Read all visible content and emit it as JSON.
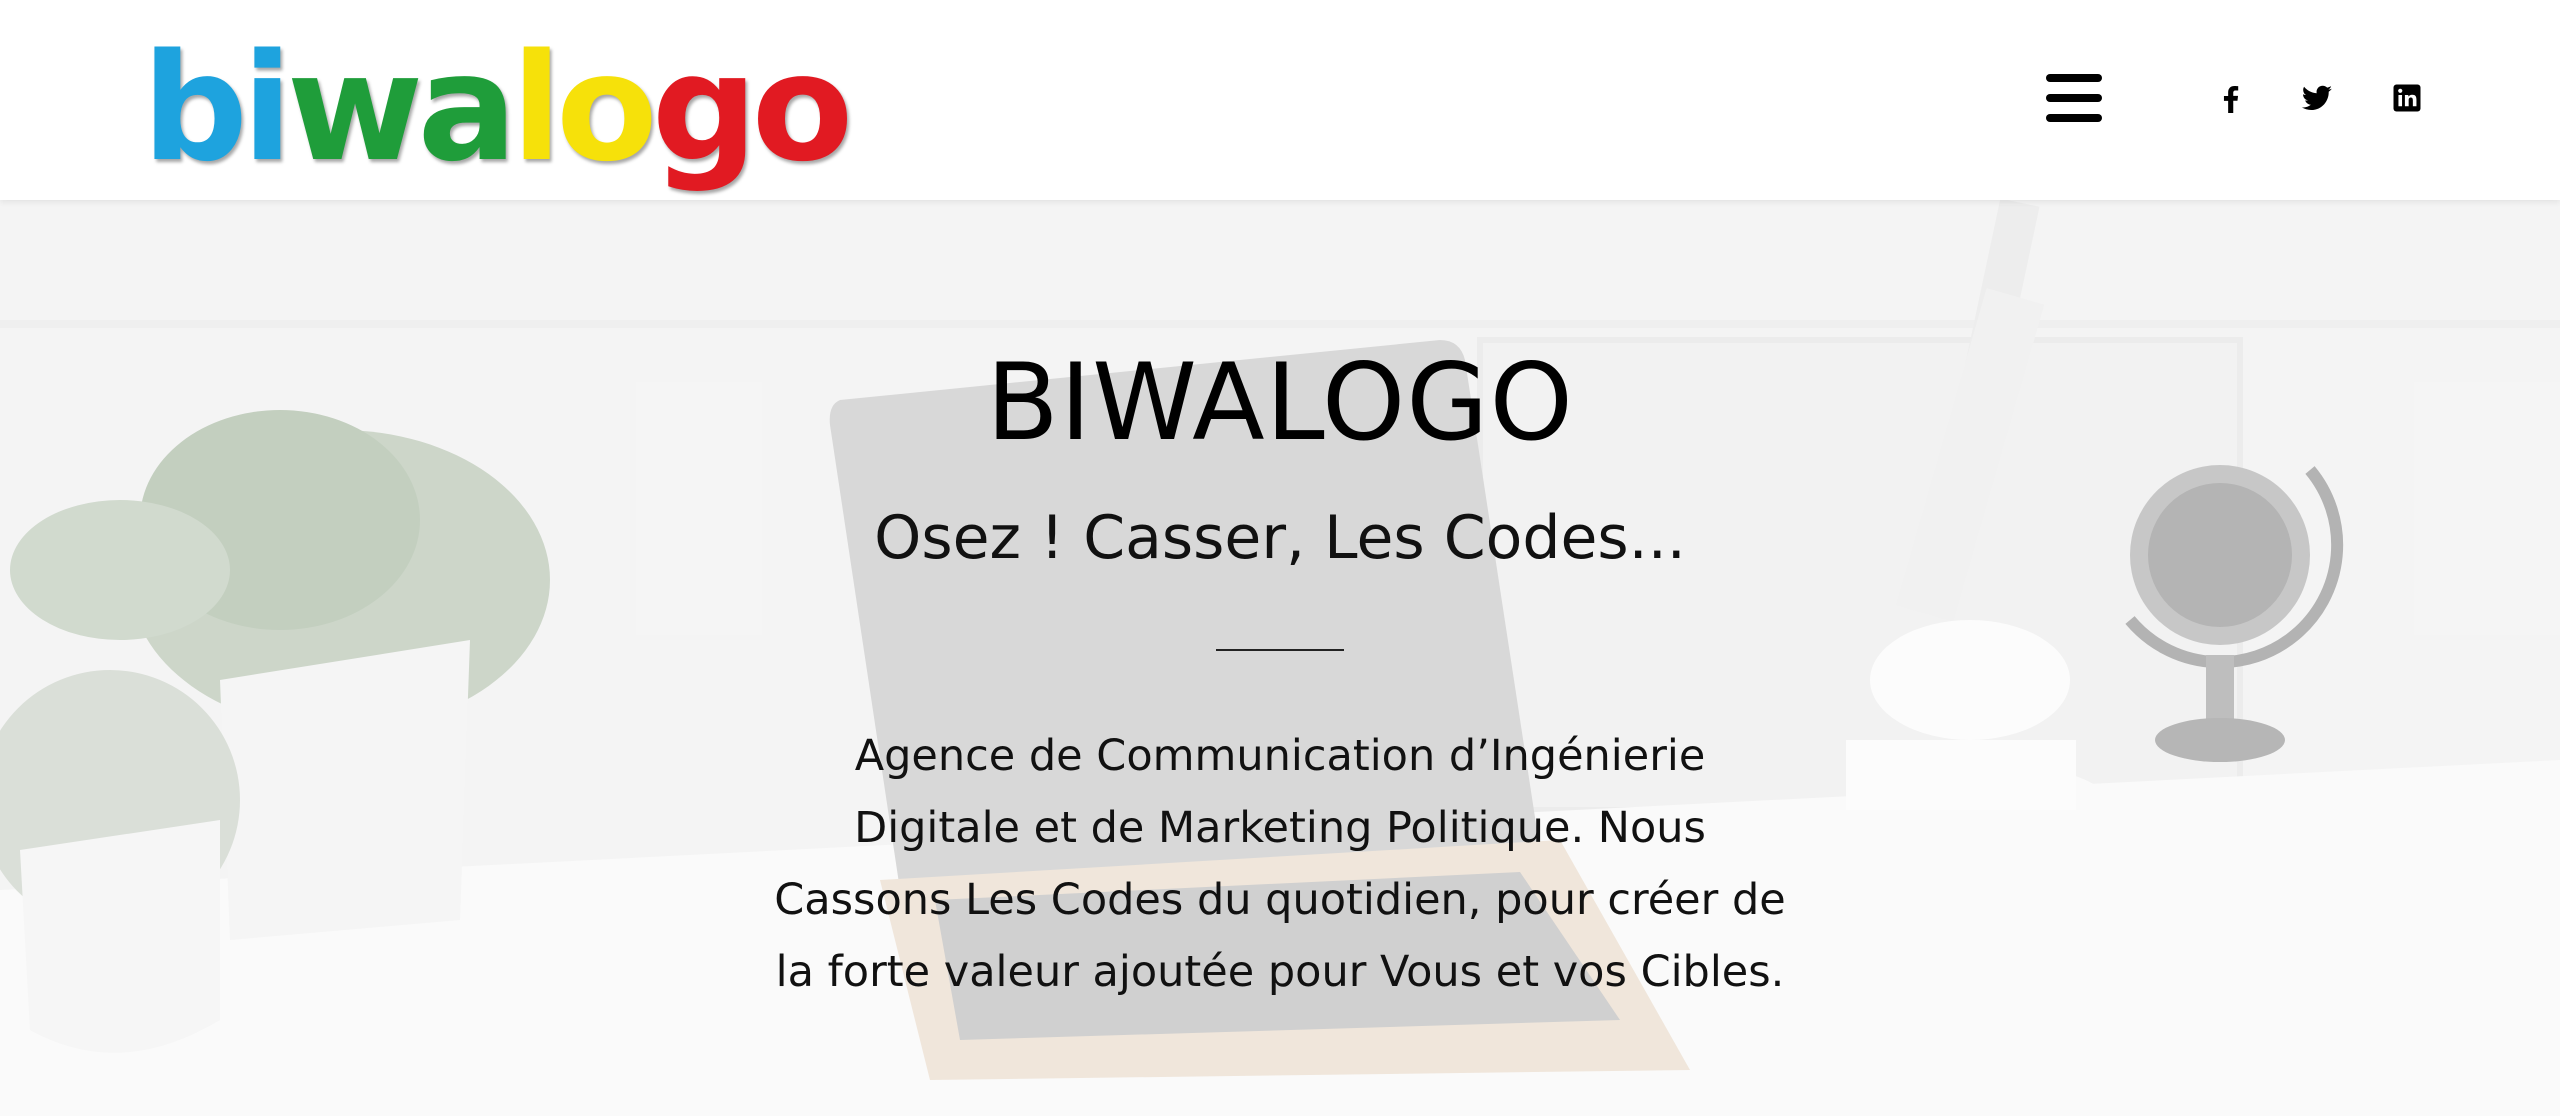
{
  "header": {
    "logo": {
      "letters": [
        {
          "char": "b",
          "color": "#1ea3de"
        },
        {
          "char": "i",
          "color": "#1ea3de"
        },
        {
          "char": "w",
          "color": "#1f9d3a"
        },
        {
          "char": "a",
          "color": "#1f9d3a"
        },
        {
          "char": "l",
          "color": "#f6e10a"
        },
        {
          "char": "o",
          "color": "#f6e10a"
        },
        {
          "char": "g",
          "color": "#e11a22"
        },
        {
          "char": "o",
          "color": "#e11a22"
        }
      ]
    },
    "menu_icon": "hamburger-menu-icon",
    "social": [
      {
        "icon": "facebook-icon"
      },
      {
        "icon": "twitter-icon"
      },
      {
        "icon": "linkedin-icon"
      }
    ]
  },
  "hero": {
    "title": "BIWALOGO",
    "subtitle": "Osez ! Casser, Les Codes...",
    "description": "Agence de Communication d’Ingénierie Digitale et de Marketing Politique. Nous Cassons Les Codes du quotidien, pour créer de la forte valeur ajoutée pour Vous et vos Cibles."
  },
  "colors": {
    "header_bg": "#ffffff",
    "hero_text": "#000000",
    "icon": "#000000"
  }
}
